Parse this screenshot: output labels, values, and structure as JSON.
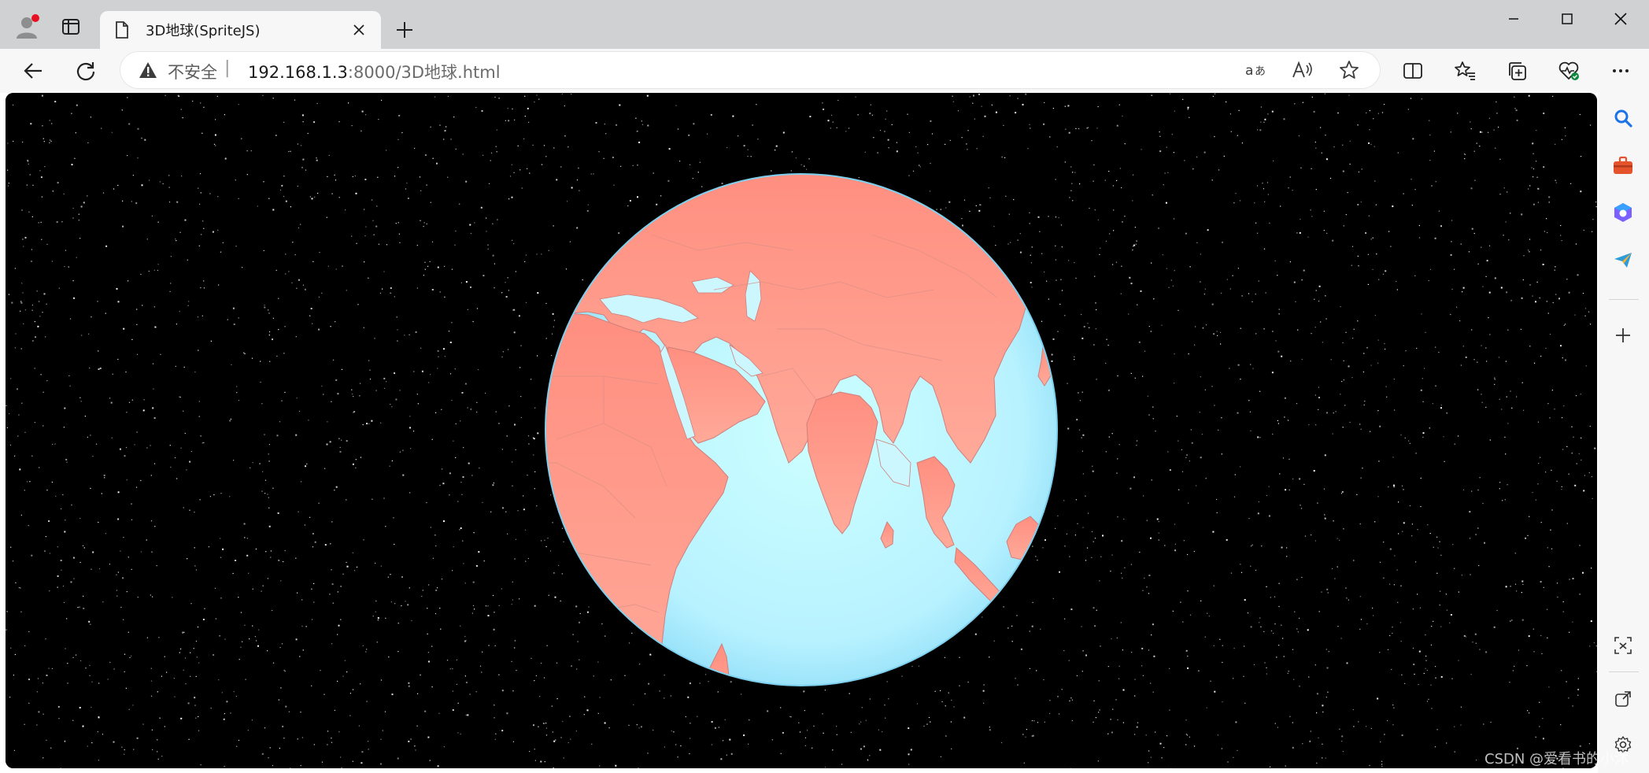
{
  "browser": {
    "tab": {
      "title": "3D地球(SpriteJS)"
    },
    "address_bar": {
      "security_label": "不安全",
      "separator": "|",
      "url_host": "192.168.1.3",
      "url_rest": ":8000/3D地球.html"
    },
    "toolbar_icons": [
      "read-aloud-translate-icon",
      "read-aloud-icon",
      "favorite-star-icon",
      "split-screen-icon",
      "favorites-icon",
      "collections-icon",
      "browser-essentials-icon",
      "more-icon"
    ],
    "sidebar_icons": [
      "search-icon",
      "tools-icon",
      "office-icon",
      "send-icon",
      "add-icon",
      "screenshot-icon",
      "open-external-icon",
      "settings-icon"
    ]
  },
  "colors": {
    "space": "#000000",
    "ocean_center": "#ccffff",
    "ocean_edge": "#9ee3fb",
    "land": "#ff9b8c",
    "land_border": "#cf8a86",
    "star": "#ffffff"
  },
  "watermark": "CSDN @爱看书的小沐"
}
